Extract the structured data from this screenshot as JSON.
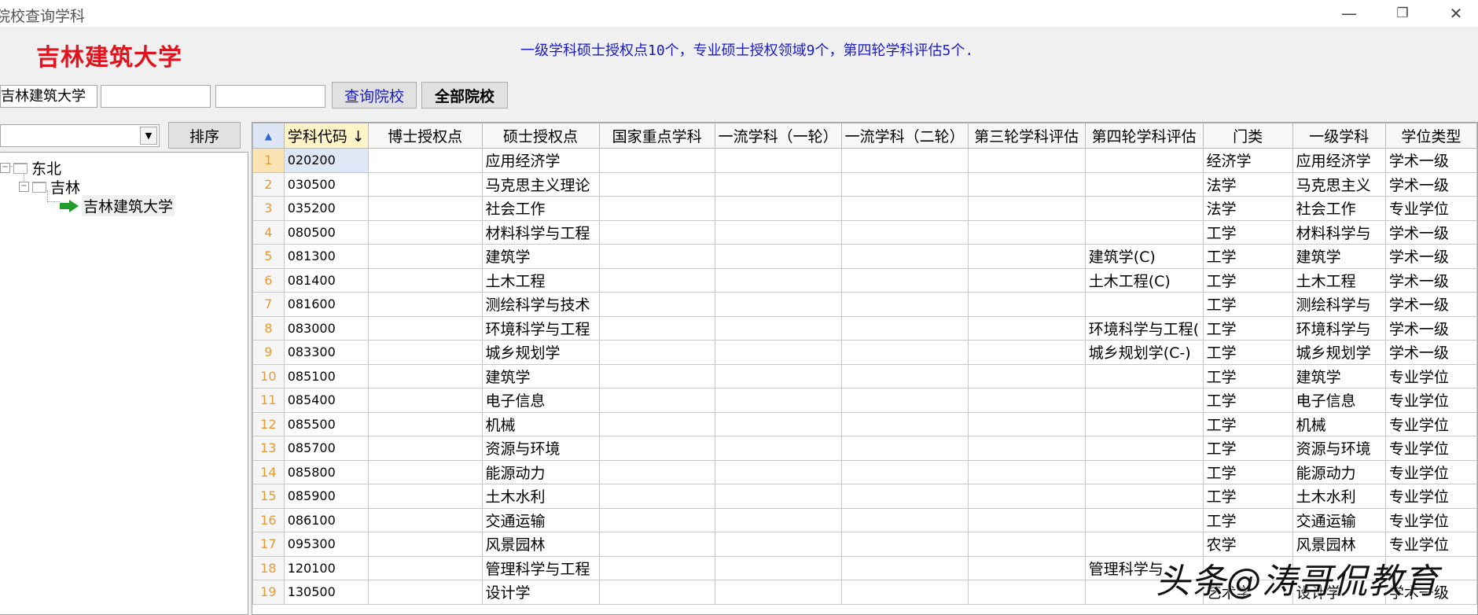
{
  "window": {
    "title": "院校查询学科",
    "minimize_glyph": "—",
    "restore_glyph": "❐",
    "close_glyph": "✕"
  },
  "header": {
    "school_name": "吉林建筑大学",
    "summary": "一级学科硕士授权点10个，专业硕士授权领域9个，第四轮学科评估5个."
  },
  "search": {
    "field1_value": "吉林建筑大学",
    "field2_value": "",
    "field3_value": "",
    "query_label": "查询院校",
    "all_label": "全部院校"
  },
  "filter": {
    "combo_value": "",
    "arrow_glyph": "▼",
    "sort_label": "排序"
  },
  "tree": {
    "region": "东北",
    "province": "吉林",
    "school": "吉林建筑大学",
    "collapse_glyph": "−"
  },
  "grid": {
    "corner_glyph": "▲",
    "columns": [
      "学科代码 ↓",
      "博士授权点",
      "硕士授权点",
      "国家重点学科",
      "一流学科（一轮）",
      "一流学科（二轮）",
      "第三轮学科评估",
      "第四轮学科评估",
      "门类",
      "一级学科",
      "学位类型"
    ],
    "rows": [
      {
        "n": "1",
        "code": "020200",
        "phd": "",
        "master": "应用经济学",
        "key": "",
        "fc1": "",
        "fc2": "",
        "e3": "",
        "e4": "",
        "cat": "经济学",
        "first": "应用经济学",
        "type": "学术一级"
      },
      {
        "n": "2",
        "code": "030500",
        "phd": "",
        "master": "马克思主义理论",
        "key": "",
        "fc1": "",
        "fc2": "",
        "e3": "",
        "e4": "",
        "cat": "法学",
        "first": "马克思主义",
        "type": "学术一级"
      },
      {
        "n": "3",
        "code": "035200",
        "phd": "",
        "master": "社会工作",
        "key": "",
        "fc1": "",
        "fc2": "",
        "e3": "",
        "e4": "",
        "cat": "法学",
        "first": "社会工作",
        "type": "专业学位"
      },
      {
        "n": "4",
        "code": "080500",
        "phd": "",
        "master": "材料科学与工程",
        "key": "",
        "fc1": "",
        "fc2": "",
        "e3": "",
        "e4": "",
        "cat": "工学",
        "first": "材料科学与",
        "type": "学术一级"
      },
      {
        "n": "5",
        "code": "081300",
        "phd": "",
        "master": "建筑学",
        "key": "",
        "fc1": "",
        "fc2": "",
        "e3": "",
        "e4": "建筑学(C)",
        "cat": "工学",
        "first": "建筑学",
        "type": "学术一级"
      },
      {
        "n": "6",
        "code": "081400",
        "phd": "",
        "master": "土木工程",
        "key": "",
        "fc1": "",
        "fc2": "",
        "e3": "",
        "e4": "土木工程(C)",
        "cat": "工学",
        "first": "土木工程",
        "type": "学术一级"
      },
      {
        "n": "7",
        "code": "081600",
        "phd": "",
        "master": "测绘科学与技术",
        "key": "",
        "fc1": "",
        "fc2": "",
        "e3": "",
        "e4": "",
        "cat": "工学",
        "first": "测绘科学与",
        "type": "学术一级"
      },
      {
        "n": "8",
        "code": "083000",
        "phd": "",
        "master": "环境科学与工程",
        "key": "",
        "fc1": "",
        "fc2": "",
        "e3": "",
        "e4": "环境科学与工程(",
        "cat": "工学",
        "first": "环境科学与",
        "type": "学术一级"
      },
      {
        "n": "9",
        "code": "083300",
        "phd": "",
        "master": "城乡规划学",
        "key": "",
        "fc1": "",
        "fc2": "",
        "e3": "",
        "e4": "城乡规划学(C-)",
        "cat": "工学",
        "first": "城乡规划学",
        "type": "学术一级"
      },
      {
        "n": "10",
        "code": "085100",
        "phd": "",
        "master": "建筑学",
        "key": "",
        "fc1": "",
        "fc2": "",
        "e3": "",
        "e4": "",
        "cat": "工学",
        "first": "建筑学",
        "type": "专业学位"
      },
      {
        "n": "11",
        "code": "085400",
        "phd": "",
        "master": "电子信息",
        "key": "",
        "fc1": "",
        "fc2": "",
        "e3": "",
        "e4": "",
        "cat": "工学",
        "first": "电子信息",
        "type": "专业学位"
      },
      {
        "n": "12",
        "code": "085500",
        "phd": "",
        "master": "机械",
        "key": "",
        "fc1": "",
        "fc2": "",
        "e3": "",
        "e4": "",
        "cat": "工学",
        "first": "机械",
        "type": "专业学位"
      },
      {
        "n": "13",
        "code": "085700",
        "phd": "",
        "master": "资源与环境",
        "key": "",
        "fc1": "",
        "fc2": "",
        "e3": "",
        "e4": "",
        "cat": "工学",
        "first": "资源与环境",
        "type": "专业学位"
      },
      {
        "n": "14",
        "code": "085800",
        "phd": "",
        "master": "能源动力",
        "key": "",
        "fc1": "",
        "fc2": "",
        "e3": "",
        "e4": "",
        "cat": "工学",
        "first": "能源动力",
        "type": "专业学位"
      },
      {
        "n": "15",
        "code": "085900",
        "phd": "",
        "master": "土木水利",
        "key": "",
        "fc1": "",
        "fc2": "",
        "e3": "",
        "e4": "",
        "cat": "工学",
        "first": "土木水利",
        "type": "专业学位"
      },
      {
        "n": "16",
        "code": "086100",
        "phd": "",
        "master": "交通运输",
        "key": "",
        "fc1": "",
        "fc2": "",
        "e3": "",
        "e4": "",
        "cat": "工学",
        "first": "交通运输",
        "type": "专业学位"
      },
      {
        "n": "17",
        "code": "095300",
        "phd": "",
        "master": "风景园林",
        "key": "",
        "fc1": "",
        "fc2": "",
        "e3": "",
        "e4": "",
        "cat": "农学",
        "first": "风景园林",
        "type": "专业学位"
      },
      {
        "n": "18",
        "code": "120100",
        "phd": "",
        "master": "管理科学与工程",
        "key": "",
        "fc1": "",
        "fc2": "",
        "e3": "",
        "e4": "管理科学与",
        "cat": "",
        "first": "",
        "type": ""
      },
      {
        "n": "19",
        "code": "130500",
        "phd": "",
        "master": "设计学",
        "key": "",
        "fc1": "",
        "fc2": "",
        "e3": "",
        "e4": "",
        "cat": "艺术学",
        "first": "设计学",
        "type": "学术一级"
      }
    ]
  },
  "watermark": "头条@涛哥侃教育",
  "colors": {
    "school_title": "#e0141e",
    "summary_text": "#1a1acc",
    "row_number": "#e69a2e",
    "selected_code_cell": "#dde7f5"
  }
}
